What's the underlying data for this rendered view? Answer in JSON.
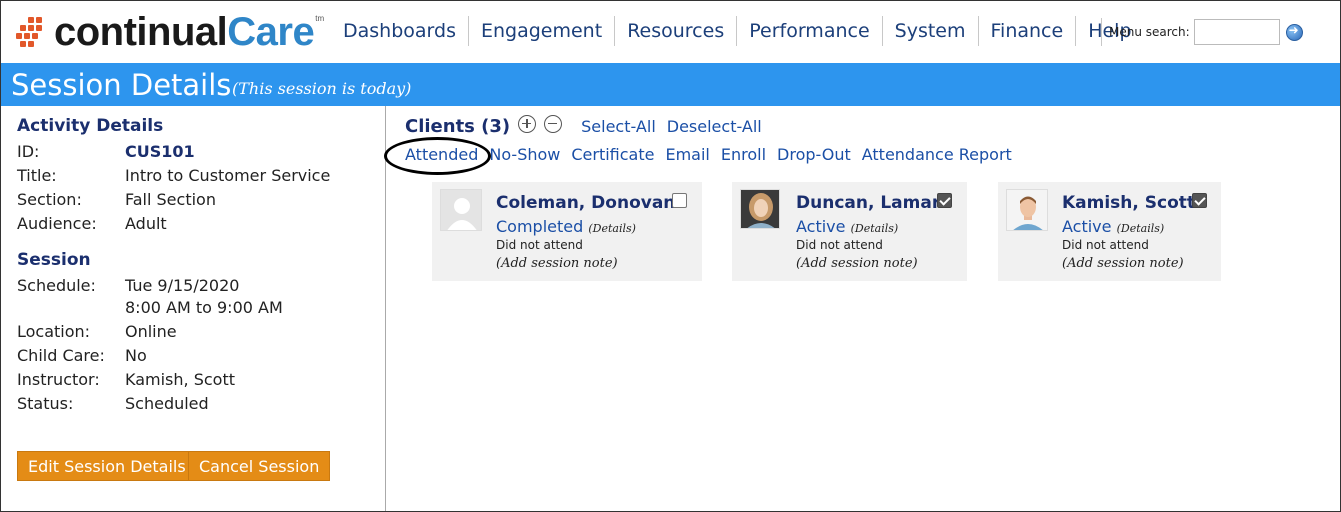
{
  "app": {
    "logo_word1": "continual",
    "logo_word2": "Care",
    "logo_tm": "tm",
    "brand_colors": {
      "accent": "#2d95ee",
      "logo_orange": "#e2582a",
      "button_orange": "#e48c16",
      "link": "#1b4fa6",
      "heading": "#1b2f6e"
    }
  },
  "nav": {
    "items": [
      "Dashboards",
      "Engagement",
      "Resources",
      "Performance",
      "System",
      "Finance",
      "Help"
    ],
    "search_label": "Menu search:",
    "search_value": "",
    "search_button_icon": "go-arrow-icon"
  },
  "header": {
    "title": "Session Details",
    "subtitle": "(This session is today)"
  },
  "activity": {
    "heading": "Activity Details",
    "fields": [
      {
        "label": "ID:",
        "value": "CUS101"
      },
      {
        "label": "Title:",
        "value": "Intro to Customer Service"
      },
      {
        "label": "Section:",
        "value": "Fall Section"
      },
      {
        "label": "Audience:",
        "value": "Adult"
      }
    ]
  },
  "session": {
    "heading": "Session",
    "schedule_label": "Schedule:",
    "schedule_date": "Tue 9/15/2020",
    "schedule_time": "8:00 AM to 9:00 AM",
    "fields": [
      {
        "label": "Location:",
        "value": "Online"
      },
      {
        "label": "Child Care:",
        "value": "No"
      },
      {
        "label": "Instructor:",
        "value": "Kamish, Scott"
      },
      {
        "label": "Status:",
        "value": "Scheduled"
      }
    ]
  },
  "buttons": {
    "edit": "Edit Session Details",
    "cancel": "Cancel Session"
  },
  "clients": {
    "title": "Clients (3)",
    "select_all": "Select-All",
    "deselect_all": "Deselect-All",
    "actions": [
      "Attended",
      "No-Show",
      "Certificate",
      "Email",
      "Enroll",
      "Drop-Out",
      "Attendance Report"
    ],
    "highlighted_action": "Attended",
    "cards": [
      {
        "name": "Coleman, Donovan",
        "status": "Completed",
        "details": "(Details)",
        "attendance": "Did not attend",
        "note": "(Add session note)",
        "checked": false,
        "avatar": "placeholder-avatar-icon"
      },
      {
        "name": "Duncan, Lamar",
        "status": "Active",
        "details": "(Details)",
        "attendance": "Did not attend",
        "note": "(Add session note)",
        "checked": true,
        "avatar": "photo-avatar"
      },
      {
        "name": "Kamish, Scott",
        "status": "Active",
        "details": "(Details)",
        "attendance": "Did not attend",
        "note": "(Add session note)",
        "checked": true,
        "avatar": "cartoon-avatar"
      }
    ]
  }
}
